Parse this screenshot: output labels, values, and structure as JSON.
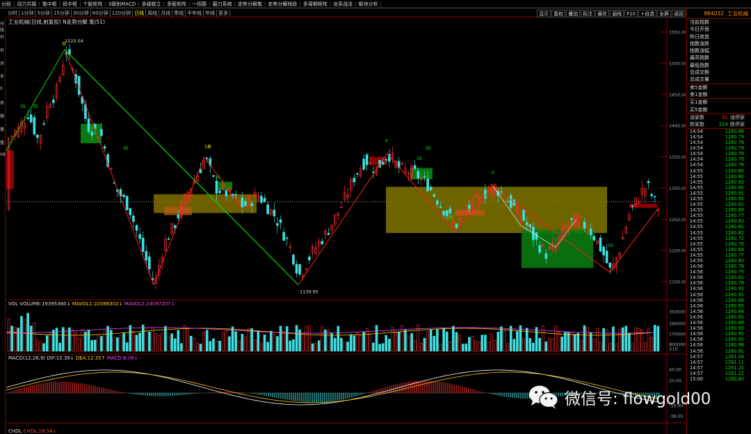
{
  "menu": [
    "分段",
    "动力共振",
    "笔中枢",
    "段中枢",
    "个股矩阵",
    "3级别MACD",
    "多级联立",
    "多股矩阵",
    "一拐筋",
    "磨刀系统",
    "走势分解笔",
    "走势分解线段",
    "多周期矩阵",
    "龙系战法",
    "板块分析"
  ],
  "periods": [
    "分时",
    "1分钟",
    "5分钟",
    "15分钟",
    "30分钟",
    "60分钟",
    "120分钟",
    "日线",
    "周线",
    "月线",
    "季线",
    "半年线",
    "年线",
    "更多"
  ],
  "active_period": "日线",
  "tools": [
    "显示",
    "复权",
    "叠加",
    "标注",
    "最优",
    "画线",
    "F10",
    "+自选",
    "全屏",
    "返回"
  ],
  "left_strip": [
    "分段",
    "价",
    "价",
    "对",
    "手",
    "0",
    "名",
    "微",
    "基",
    "盘",
    "08"
  ],
  "chart": {
    "title": "工业机械(日线,前复权) N走势分解 笔(51)",
    "yticks": [
      "1550.00",
      "1500.00",
      "1450.00",
      "1400.00",
      "1350.00",
      "1300.00",
      "1250.00",
      "1200.00",
      "1150.00"
    ],
    "high_label": "1522.04",
    "low_label": "1139.95",
    "annotations": [
      "日",
      "3S",
      "3S",
      "3S",
      "1卖",
      "3S",
      "P",
      "3S",
      "3S",
      "3S",
      "P",
      "3S"
    ],
    "vol_title": "VOL VOLUME:19395360↓",
    "vol_ma1": "MAVOL1:22088302↓",
    "vol_ma2": "MAVOL2:24097207↓",
    "vol_ticks": [
      "3500000",
      "2600000",
      "1700000",
      "800000"
    ],
    "vol_unit": "X10",
    "macd_title": "MACD(12,26,9) DIF:15.39↓",
    "macd_dea": "DEA:12.35↑",
    "macd_val": "MACD:6.09↓",
    "macd_ticks": [
      "40.00",
      "20.00",
      "-19.00",
      "-38.00"
    ],
    "chdl_title": "CHDL",
    "chdl_val": "CHDL:18.54↓"
  },
  "right": {
    "code": "884032",
    "name": "工业机械",
    "stats": [
      "当前指数",
      "今日开盘",
      "昨日收盘",
      "指数涨跌",
      "指数涨幅",
      "最高指数",
      "最低指数",
      "总成交额",
      "总成交量"
    ],
    "sell5": "卖5金额",
    "sell1": "卖1金额",
    "buy1": "买1金额",
    "buy5": "买5金额",
    "up_label": "涨家数",
    "up_count": "51",
    "up_stop": "涨停家",
    "down_label": "跌家数",
    "down_count": "224",
    "down_stop": "跌停家",
    "ticks": [
      [
        "14:54",
        "1260.88"
      ],
      [
        "14:54",
        "1260.79"
      ],
      [
        "14:54",
        "1260.78"
      ],
      [
        "14:54",
        "1260.79"
      ],
      [
        "14:54",
        "1260.78"
      ],
      [
        "14:54",
        "1260.79"
      ],
      [
        "14:54",
        "1260.78"
      ],
      [
        "14:55",
        "1260.80"
      ],
      [
        "14:55",
        "1260.82"
      ],
      [
        "14:55",
        "1260.83"
      ],
      [
        "14:55",
        "1260.85"
      ],
      [
        "14:55",
        "1260.91"
      ],
      [
        "14:55",
        "1260.92"
      ],
      [
        "14:55",
        "1260.91"
      ],
      [
        "14:55",
        "1260.89"
      ],
      [
        "14:55",
        "1260.77"
      ],
      [
        "14:55",
        "1260.82"
      ],
      [
        "14:55",
        "1260.81"
      ],
      [
        "14:55",
        "1260.82"
      ],
      [
        "14:55",
        "1260.72"
      ],
      [
        "14:55",
        "1260.76"
      ],
      [
        "14:55",
        "1260.84"
      ],
      [
        "14:55",
        "1260.77"
      ],
      [
        "14:55",
        "1260.80"
      ],
      [
        "14:56",
        "1260.78"
      ],
      [
        "14:56",
        "1260.75"
      ],
      [
        "14:56",
        "1260.81"
      ],
      [
        "14:56",
        "1260.78"
      ],
      [
        "14:56",
        "1260.93"
      ],
      [
        "14:56",
        "1260.91"
      ],
      [
        "14:56",
        "1260.86"
      ],
      [
        "14:56",
        "1260.85"
      ],
      [
        "14:56",
        "1260.84"
      ],
      [
        "14:56",
        "1260.81"
      ],
      [
        "14:56",
        "1260.88"
      ],
      [
        "14:56",
        "1260.93"
      ],
      [
        "14:56",
        "1260.95"
      ],
      [
        "14:56",
        "1260.91"
      ],
      [
        "14:56",
        "1260.98"
      ],
      [
        "14:56",
        "1260.91"
      ],
      [
        "14:57",
        "1261.04"
      ],
      [
        "14:57",
        "1261.11"
      ],
      [
        "14:57",
        "1261.20"
      ],
      [
        "14:57",
        "1261.22"
      ],
      [
        "15:00",
        "1260.80"
      ]
    ]
  },
  "watermark": "微信号: flowgold00",
  "colors": {
    "up": "#ff3030",
    "down": "#40e0e0",
    "zs_yellow": "#808000",
    "zs_green": "#007000",
    "bi_green": "#00e000",
    "bi_red": "#ff2020"
  }
}
